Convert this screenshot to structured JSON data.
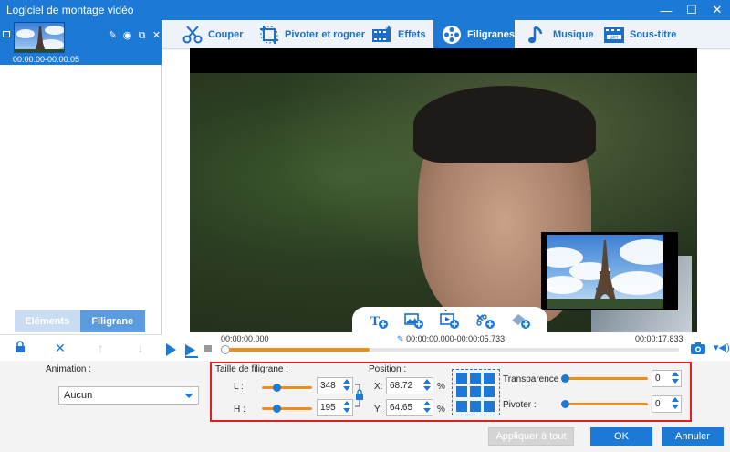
{
  "window": {
    "title": "Logiciel de montage vidéo",
    "min": "—",
    "max": "☐",
    "close": "✕"
  },
  "clip": {
    "time": "00:00:00-00:00:05"
  },
  "toolbar": {
    "couper": "Couper",
    "pivoter": "Pivoter et rogner",
    "effets": "Effets",
    "filigranes": "Filigranes",
    "musique": "Musique",
    "soustitre": "Sous-titre"
  },
  "left_tabs": {
    "elements": "Eléments",
    "filigrane": "Filigrane"
  },
  "timeline": {
    "start": "00:00:00.000",
    "range": "00:00:00.000-00:00:05.733",
    "end": "00:00:17.833",
    "progress": 0.32
  },
  "animation": {
    "label": "Animation :",
    "value": "Aucun"
  },
  "size": {
    "label": "Taille de filigrane :",
    "l_label": "L :",
    "l_value": "348",
    "h_label": "H :",
    "h_value": "195"
  },
  "position": {
    "label": "Position :",
    "x_label": "X:",
    "x_value": "68.72",
    "y_label": "Y:",
    "y_value": "64.65",
    "unit": "%"
  },
  "transparence": {
    "label": "Transparence :",
    "value": "0"
  },
  "pivoter": {
    "label": "Pivoter :",
    "value": "0"
  },
  "buttons": {
    "apply_all": "Appliquer à tout",
    "ok": "OK",
    "cancel": "Annuler"
  },
  "colors": {
    "accent": "#1c7ad6",
    "slider": "#f08c1a",
    "highlight": "#e0201e"
  }
}
